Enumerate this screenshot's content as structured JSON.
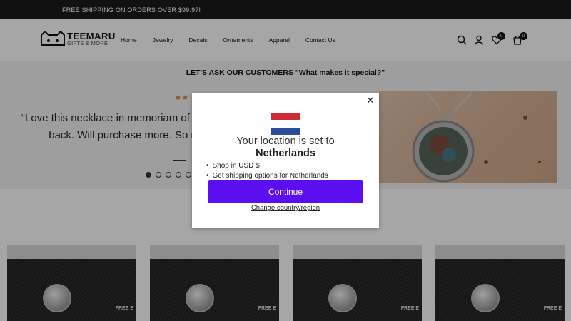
{
  "announcement": {
    "text": "FREE SHIPPING ON ORDERS OVER $99.97!"
  },
  "brand": {
    "name": "TEEMARU",
    "tagline": "GIFTS & MORE"
  },
  "nav": {
    "items": [
      "Home",
      "Jewelry",
      "Decals",
      "Ornaments",
      "Apparel",
      "Contact Us"
    ]
  },
  "header_icons": {
    "search": "search-icon",
    "account": "user-icon",
    "wishlist": "heart-icon",
    "wishlist_count": "0",
    "cart": "cart-icon",
    "cart_count": "0"
  },
  "testimonial": {
    "heading": "LET'S ASK OUR CUSTOMERS \"What makes it special?\"",
    "stars": "★★",
    "quote_line1": "“Love this necklace in memoriam of m",
    "quote_line2": "back. Will purchase more. So m",
    "slides": 5,
    "active_slide": 0
  },
  "products": {
    "badge_text": [
      "FREE E",
      "FREE E",
      "FREE E",
      "FREE E"
    ]
  },
  "location_modal": {
    "location_prefix": "Your location is set to",
    "country": "Netherlands",
    "bullets": [
      "Shop in USD $",
      "Get shipping options for Netherlands"
    ],
    "continue_label": "Continue",
    "change_label": "Change country/region",
    "flag_colors": [
      "#cf2b33",
      "#ffffff",
      "#2a4c9a"
    ],
    "accent": "#5b0ef0"
  }
}
